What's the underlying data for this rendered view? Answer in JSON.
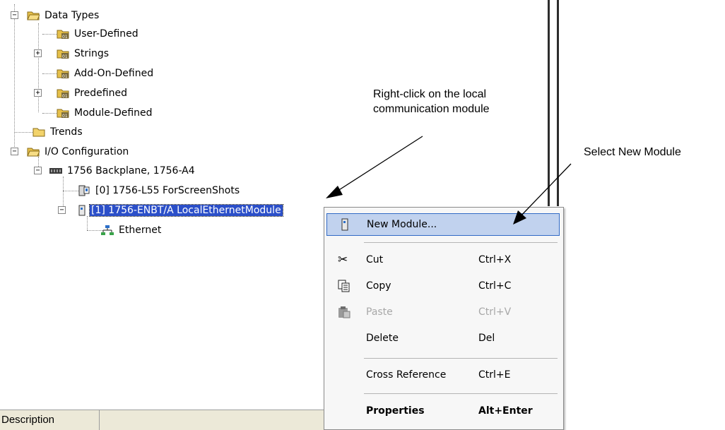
{
  "tree": {
    "items": [
      {
        "label": "Data Types",
        "level": 0,
        "icon": "folder-open-icon",
        "expander": "minus"
      },
      {
        "label": "User-Defined",
        "level": 1,
        "icon": "data-type-folder-icon",
        "expander": ""
      },
      {
        "label": "Strings",
        "level": 1,
        "icon": "data-type-folder-icon",
        "expander": "plus"
      },
      {
        "label": "Add-On-Defined",
        "level": 1,
        "icon": "data-type-folder-icon",
        "expander": ""
      },
      {
        "label": "Predefined",
        "level": 1,
        "icon": "data-type-folder-icon",
        "expander": "plus"
      },
      {
        "label": "Module-Defined",
        "level": 1,
        "icon": "data-type-folder-icon",
        "expander": ""
      },
      {
        "label": "Trends",
        "level": 0,
        "icon": "folder-icon",
        "expander": ""
      },
      {
        "label": "I/O Configuration",
        "level": 0,
        "icon": "folder-open-icon",
        "expander": "minus"
      },
      {
        "label": "1756 Backplane, 1756-A4",
        "level": 1,
        "icon": "backplane-icon",
        "expander": "minus"
      },
      {
        "label": "[0] 1756-L55 ForScreenShots",
        "level": 2,
        "icon": "controller-icon",
        "expander": ""
      },
      {
        "label": "[1] 1756-ENBT/A LocalEthernetModule",
        "level": 2,
        "icon": "module-icon",
        "expander": "minus",
        "selected": true
      },
      {
        "label": "Ethernet",
        "level": 3,
        "icon": "network-icon",
        "expander": ""
      }
    ]
  },
  "context_menu": {
    "items": [
      {
        "label": "New Module...",
        "shortcut": "",
        "icon": "new-module-icon",
        "highlight": true
      },
      {
        "label": "Cut",
        "shortcut": "Ctrl+X",
        "icon": "scissors-icon"
      },
      {
        "label": "Copy",
        "shortcut": "Ctrl+C",
        "icon": "copy-icon"
      },
      {
        "label": "Paste",
        "shortcut": "Ctrl+V",
        "icon": "paste-icon",
        "disabled": true
      },
      {
        "label": "Delete",
        "shortcut": "Del",
        "icon": ""
      },
      {
        "label": "Cross Reference",
        "shortcut": "Ctrl+E",
        "icon": ""
      },
      {
        "label": "Properties",
        "shortcut": "Alt+Enter",
        "icon": "",
        "bold": true
      }
    ]
  },
  "description_bar": {
    "label": "Description"
  },
  "annotations": {
    "right_click_line1": "Right-click on the local",
    "right_click_line2": "communication module",
    "select_new_module": "Select New Module"
  },
  "colors": {
    "selection": "#2b4fc9",
    "menu_highlight": "#c1d2ee",
    "menu_highlight_border": "#316ac5",
    "folder": "#f2d36b"
  }
}
